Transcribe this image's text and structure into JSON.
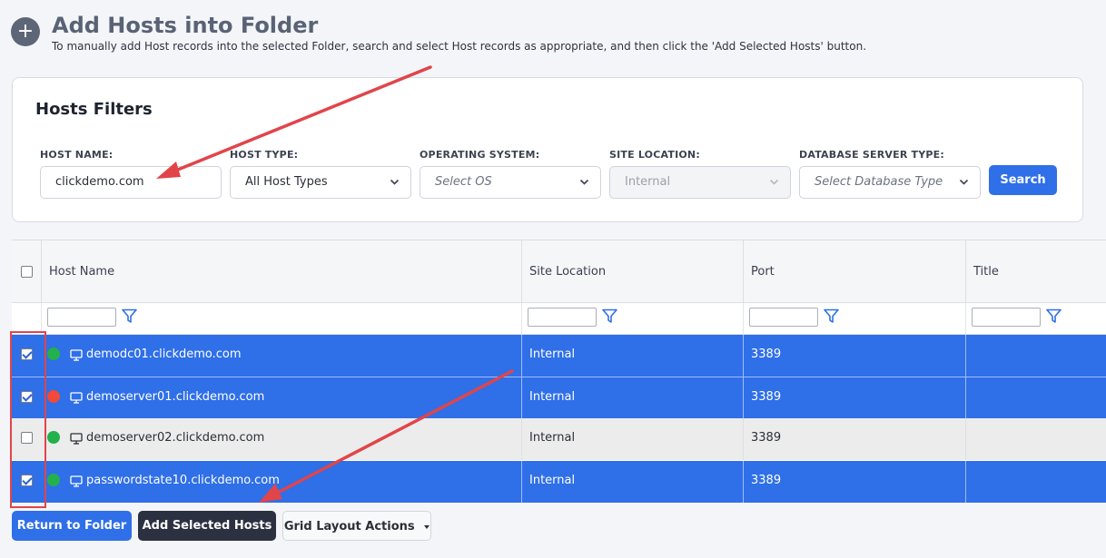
{
  "header": {
    "title": "Add Hosts into Folder",
    "description": "To manually add Host records into the selected Folder, search and select Host records as appropriate, and then click the 'Add Selected Hosts' button.",
    "add_icon_glyph": "+"
  },
  "filters": {
    "title": "Hosts Filters",
    "host_name": {
      "label": "HOST NAME:",
      "value": "clickdemo.com"
    },
    "host_type": {
      "label": "HOST TYPE:",
      "value": "All Host Types"
    },
    "operating_system": {
      "label": "OPERATING SYSTEM:",
      "placeholder": "Select OS"
    },
    "site_location": {
      "label": "SITE LOCATION:",
      "value": "Internal"
    },
    "database_server_type": {
      "label": "DATABASE SERVER TYPE:",
      "placeholder": "Select Database Type"
    },
    "search_label": "Search"
  },
  "grid": {
    "columns": [
      "Host Name",
      "Site Location",
      "Port",
      "Title"
    ],
    "rows": [
      {
        "checked": true,
        "status": "green",
        "host_name": "demodc01.clickdemo.com",
        "site_location": "Internal",
        "port": "3389",
        "title": ""
      },
      {
        "checked": true,
        "status": "red",
        "host_name": "demoserver01.clickdemo.com",
        "site_location": "Internal",
        "port": "3389",
        "title": ""
      },
      {
        "checked": false,
        "status": "green",
        "host_name": "demoserver02.clickdemo.com",
        "site_location": "Internal",
        "port": "3389",
        "title": ""
      },
      {
        "checked": true,
        "status": "green",
        "host_name": "passwordstate10.clickdemo.com",
        "site_location": "Internal",
        "port": "3389",
        "title": ""
      }
    ]
  },
  "footer": {
    "return_label": "Return to Folder",
    "add_selected_label": "Add Selected Hosts",
    "grid_layout_label": "Grid Layout Actions"
  },
  "colors": {
    "accent": "#2f6fe8",
    "dark_button": "#2b3140",
    "status_green": "#22b14c",
    "status_red": "#f04a3a",
    "annotation_red": "#e0454a"
  }
}
